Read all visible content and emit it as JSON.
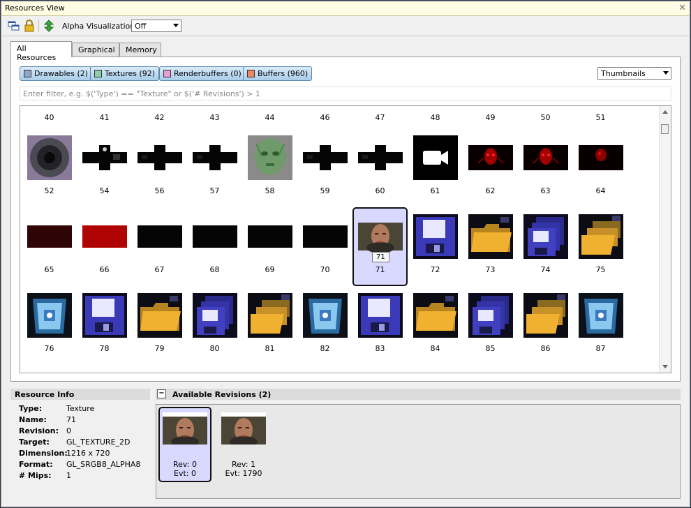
{
  "window": {
    "title": "Resources View"
  },
  "toolbar": {
    "alpha_label": "Alpha Visualization:",
    "alpha_value": "Off"
  },
  "tabs": [
    "All Resources",
    "Graphical",
    "Memory"
  ],
  "filters": [
    {
      "label": "Drawables (2)",
      "color": "#8fa6c7"
    },
    {
      "label": "Textures (92)",
      "color": "#8fd0a8"
    },
    {
      "label": "Renderbuffers (0)",
      "color": "#e8a0d0"
    },
    {
      "label": "Buffers (960)",
      "color": "#f08860"
    }
  ],
  "view_mode": "Thumbnails",
  "filter_placeholder": "Enter filter, e.g. $('Type') == \"Texture\" or $('# Revisions') > 1",
  "rows": [
    {
      "headers": [
        "40",
        "41",
        "42",
        "43",
        "44",
        "46",
        "47",
        "48",
        "49",
        "50",
        "51"
      ],
      "items": [
        {
          "label": "52",
          "thumb": "eye"
        },
        {
          "label": "54",
          "thumb": "cross-hole"
        },
        {
          "label": "56",
          "thumb": "cross"
        },
        {
          "label": "57",
          "thumb": "cross"
        },
        {
          "label": "58",
          "thumb": "green-face"
        },
        {
          "label": "59",
          "thumb": "cross"
        },
        {
          "label": "60",
          "thumb": "cross"
        },
        {
          "label": "61",
          "thumb": "camera"
        },
        {
          "label": "62",
          "thumb": "red-face"
        },
        {
          "label": "63",
          "thumb": "red-face"
        },
        {
          "label": "64",
          "thumb": "red-face-dark"
        }
      ]
    },
    {
      "items": [
        {
          "label": "65",
          "thumb": "dark-red-bar"
        },
        {
          "label": "66",
          "thumb": "red-bar"
        },
        {
          "label": "67",
          "thumb": "black-bar"
        },
        {
          "label": "68",
          "thumb": "black-bar"
        },
        {
          "label": "69",
          "thumb": "black-bar"
        },
        {
          "label": "70",
          "thumb": "black-bar"
        },
        {
          "label": "71",
          "thumb": "face",
          "selected": true,
          "tooltip": "71"
        },
        {
          "label": "72",
          "thumb": "floppy"
        },
        {
          "label": "73",
          "thumb": "folder"
        },
        {
          "label": "74",
          "thumb": "floppies"
        },
        {
          "label": "75",
          "thumb": "folders"
        }
      ]
    },
    {
      "items": [
        {
          "label": "76",
          "thumb": "bin"
        },
        {
          "label": "78",
          "thumb": "floppy"
        },
        {
          "label": "79",
          "thumb": "folder"
        },
        {
          "label": "80",
          "thumb": "floppies"
        },
        {
          "label": "81",
          "thumb": "folders"
        },
        {
          "label": "82",
          "thumb": "bin"
        },
        {
          "label": "83",
          "thumb": "floppy"
        },
        {
          "label": "84",
          "thumb": "folder"
        },
        {
          "label": "85",
          "thumb": "floppies"
        },
        {
          "label": "86",
          "thumb": "folders"
        },
        {
          "label": "87",
          "thumb": "bin"
        }
      ]
    }
  ],
  "resource_info": {
    "title": "Resource Info",
    "rows": [
      {
        "k": "Type:",
        "v": "Texture"
      },
      {
        "k": "Name:",
        "v": "71"
      },
      {
        "k": "Revision:",
        "v": "0"
      },
      {
        "k": "Target:",
        "v": "GL_TEXTURE_2D"
      },
      {
        "k": "Dimension:",
        "v": "1216 x 720"
      },
      {
        "k": "Format:",
        "v": "GL_SRGB8_ALPHA8"
      },
      {
        "k": "# Mips:",
        "v": "1"
      }
    ]
  },
  "revisions": {
    "title": "Available Revisions (2)",
    "items": [
      {
        "rev": "Rev: 0",
        "evt": "Evt: 0",
        "selected": true
      },
      {
        "rev": "Rev: 1",
        "evt": "Evt: 1790",
        "selected": false
      }
    ]
  }
}
